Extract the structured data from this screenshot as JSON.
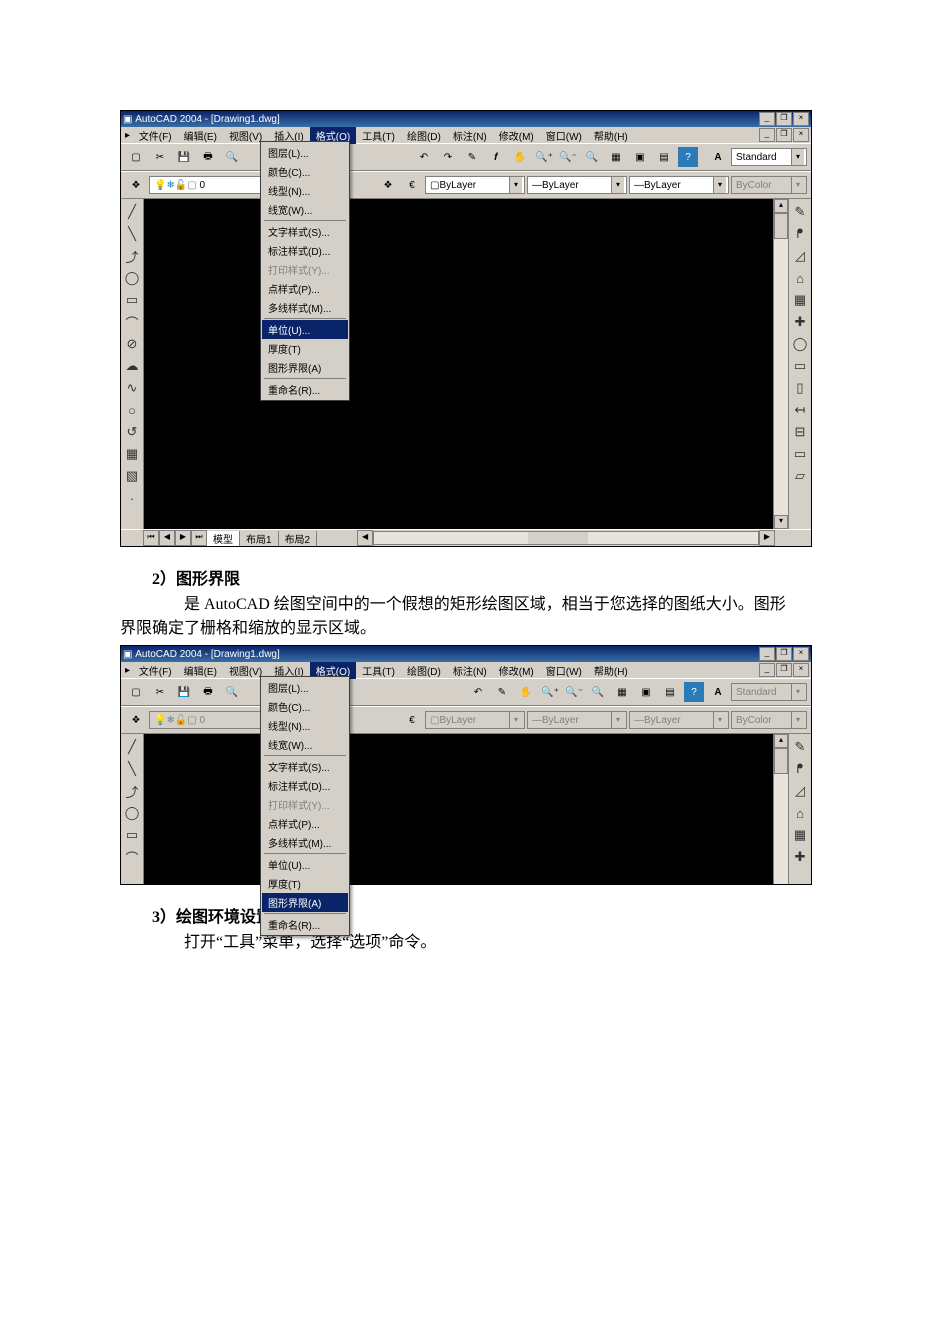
{
  "sections": {
    "s2": {
      "heading": "2）图形界限",
      "body1_html": "是 AutoCAD 绘图空间中的一个假想的矩形绘图区域，相当于您选择的图纸大小。图形",
      "body2": "界限确定了栅格和缩放的显示区域。"
    },
    "s3": {
      "heading": "3）绘图环境设置",
      "body1": "打开“工具”菜单，选择“选项”命令。"
    }
  },
  "shot1": {
    "title": "AutoCAD 2004 - [Drawing1.dwg]",
    "menus": [
      "文件(F)",
      "编辑(E)",
      "视图(V)",
      "插入(I)",
      "格式(O)",
      "工具(T)",
      "绘图(D)",
      "标注(N)",
      "修改(M)",
      "窗口(W)",
      "帮助(H)"
    ],
    "active_menu_index": 4,
    "layer_combo": "0",
    "bylayer1": "ByLayer",
    "bylayer2": "ByLayer",
    "bylayer3": "ByLayer",
    "bycolor": "ByColor",
    "text_style": "Standard",
    "dropdown": {
      "group1": [
        "图层(L)...",
        "颜色(C)...",
        "线型(N)...",
        "线宽(W)..."
      ],
      "group2": [
        "文字样式(S)...",
        "标注样式(D)...",
        "打印样式(Y)...",
        "点样式(P)...",
        "多线样式(M)..."
      ],
      "group3": [
        "单位(U)...",
        "厚度(T)",
        "图形界限(A)"
      ],
      "group4": [
        "重命名(R)..."
      ],
      "disabled_index": 2,
      "highlight_index": 0
    },
    "tabs": [
      "模型",
      "布局1",
      "布局2"
    ],
    "left_icons": [
      "╱",
      "╲",
      "⤴",
      "◯",
      "▭",
      "⌒",
      "⊘",
      "☁",
      "∿",
      "○",
      "↺",
      "▦",
      "▧"
    ],
    "right_icons": [
      "✎",
      "ᖰ",
      "◿",
      "⌂",
      "▦",
      "✚",
      "◯",
      "▭",
      "▯",
      "↤",
      "⊟",
      "▭",
      "▱"
    ]
  },
  "shot2": {
    "title": "AutoCAD 2004 - [Drawing1.dwg]",
    "menus": [
      "文件(F)",
      "编辑(E)",
      "视图(V)",
      "插入(I)",
      "格式(O)",
      "工具(T)",
      "绘图(D)",
      "标注(N)",
      "修改(M)",
      "窗口(W)",
      "帮助(H)"
    ],
    "active_menu_index": 4,
    "layer_combo": "0",
    "bylayer1": "ByLayer",
    "bylayer2": "ByLayer",
    "bylayer3": "ByLayer",
    "bycolor": "ByColor",
    "text_style": "Standard",
    "dropdown": {
      "group1": [
        "图层(L)...",
        "颜色(C)...",
        "线型(N)...",
        "线宽(W)..."
      ],
      "group2": [
        "文字样式(S)...",
        "标注样式(D)...",
        "打印样式(Y)...",
        "点样式(P)...",
        "多线样式(M)..."
      ],
      "group3": [
        "单位(U)...",
        "厚度(T)",
        "图形界限(A)"
      ],
      "group4": [
        "重命名(R)..."
      ],
      "disabled_index": 2,
      "highlight_index": 2
    },
    "left_icons": [
      "╱",
      "╲",
      "⤴",
      "◯",
      "▭",
      "⌒"
    ],
    "right_icons": [
      "✎",
      "ᖰ",
      "◿",
      "⌂",
      "▦",
      "✚"
    ]
  }
}
